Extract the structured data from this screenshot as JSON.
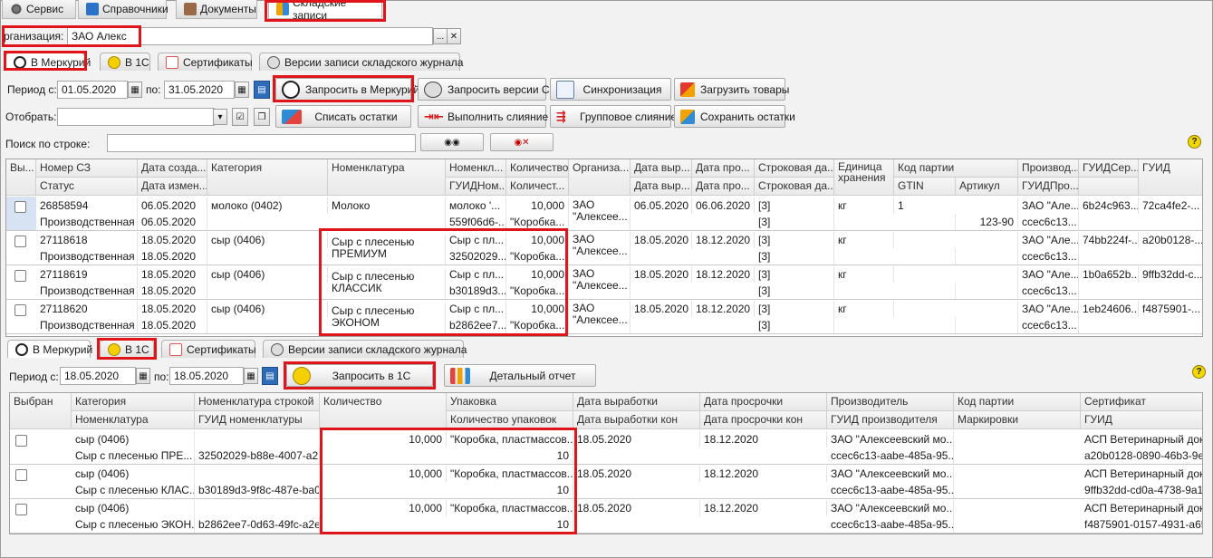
{
  "top_tabs": [
    {
      "label": "Сервис",
      "icon": "gear-icon"
    },
    {
      "label": "Справочники",
      "icon": "directory-icon"
    },
    {
      "label": "Документы",
      "icon": "documents-icon"
    },
    {
      "label": "Складские записи",
      "icon": "warehouse-icon"
    }
  ],
  "org": {
    "label": "рганизация:",
    "value": "ЗАО  Алекс"
  },
  "sub_tabs_top": [
    {
      "label": "В Меркурий",
      "icon": "mercury-icon"
    },
    {
      "label": "В 1С",
      "icon": "1c-icon"
    },
    {
      "label": "Сертификаты",
      "icon": "certificate-icon"
    },
    {
      "label": "Версии записи складского журнала",
      "icon": "versions-icon"
    }
  ],
  "filters": {
    "period_label": "Период с:",
    "from": "01.05.2020",
    "to_label": "по:",
    "to": "31.05.2020",
    "select_label": "Отобрать:",
    "select_value": "",
    "search_label": "Поиск по строке:",
    "search_value": ""
  },
  "buttons_top": {
    "request_mercury": "Запросить в Меркурий",
    "request_versions": "Запросить версии СЗ",
    "sync": "Синхронизация",
    "load_goods": "Загрузить товары",
    "write_off": "Списать остатки",
    "merge": "Выполнить слияние",
    "group_merge": "Групповое слияние",
    "save_rest": "Сохранить остатки"
  },
  "grid1": {
    "headers_row1": [
      "Вы...",
      "Номер СЗ",
      "Дата созда...",
      "Категория",
      "Номенклатура",
      "Номенкл...",
      "Количество",
      "Организа...",
      "Дата выр...",
      "Дата про...",
      "Строковая да...",
      "Единица хранения",
      "Код партии",
      "",
      "Производ...",
      "ГУИДСер...",
      "ГУИД"
    ],
    "headers_row2": [
      "",
      "Статус",
      "Дата измен...",
      "",
      "",
      "ГУИДНом...",
      "Количест...",
      "",
      "Дата выр...",
      "Дата про...",
      "Строковая да...",
      "",
      "GTIN",
      "Артикул",
      "ГУИДПро...",
      "",
      ""
    ],
    "rows": [
      {
        "num": "26858594",
        "status": "Производственная",
        "created": "06.05.2020",
        "changed": "06.05.2020",
        "category": "молоко (0402)",
        "nomen": "Молоко",
        "nomen_short": "молоко '...",
        "nomen_guid": "559f06d6-...",
        "qty": "10,000",
        "qty2": "\"Коробка...",
        "org": "ЗАО \"Алексее...",
        "prod_date": "06.05.2020",
        "exp_date": "06.06.2020",
        "str1": "[3]",
        "str2": "[3]",
        "unit": "кг",
        "batch": "1",
        "gtin": "",
        "article": "123-90",
        "producer": "ЗАО \"Але...",
        "producer_guid": "ccec6c13...",
        "cert_guid": "6b24c963...",
        "guid": "72ca4fe2-..."
      },
      {
        "num": "27118618",
        "status": "Производственная",
        "created": "18.05.2020",
        "changed": "18.05.2020",
        "category": "сыр (0406)",
        "nomen": "Сыр с плесенью ПРЕМИУМ",
        "nomen_short": "Сыр с пл...",
        "nomen_guid": "32502029...",
        "qty": "10,000",
        "qty2": "\"Коробка...",
        "org": "ЗАО \"Алексее...",
        "prod_date": "18.05.2020",
        "exp_date": "18.12.2020",
        "str1": "[3]",
        "str2": "[3]",
        "unit": "кг",
        "batch": "",
        "gtin": "",
        "article": "",
        "producer": "ЗАО \"Але...",
        "producer_guid": "ccec6c13...",
        "cert_guid": "74bb224f-...",
        "guid": "a20b0128-..."
      },
      {
        "num": "27118619",
        "status": "Производственная",
        "created": "18.05.2020",
        "changed": "18.05.2020",
        "category": "сыр (0406)",
        "nomen": "Сыр с плесенью КЛАССИК",
        "nomen_short": "Сыр с пл...",
        "nomen_guid": "b30189d3...",
        "qty": "10,000",
        "qty2": "\"Коробка...",
        "org": "ЗАО \"Алексее...",
        "prod_date": "18.05.2020",
        "exp_date": "18.12.2020",
        "str1": "[3]",
        "str2": "[3]",
        "unit": "кг",
        "batch": "",
        "gtin": "",
        "article": "",
        "producer": "ЗАО \"Але...",
        "producer_guid": "ccec6c13...",
        "cert_guid": "1b0a652b...",
        "guid": "9ffb32dd-c..."
      },
      {
        "num": "27118620",
        "status": "Производственная",
        "created": "18.05.2020",
        "changed": "18.05.2020",
        "category": "сыр (0406)",
        "nomen": "Сыр с плесенью ЭКОНОМ",
        "nomen_short": "Сыр с пл...",
        "nomen_guid": "b2862ee7...",
        "qty": "10,000",
        "qty2": "\"Коробка...",
        "org": "ЗАО \"Алексее...",
        "prod_date": "18.05.2020",
        "exp_date": "18.12.2020",
        "str1": "[3]",
        "str2": "[3]",
        "unit": "кг",
        "batch": "",
        "gtin": "",
        "article": "",
        "producer": "ЗАО \"Але...",
        "producer_guid": "ccec6c13...",
        "cert_guid": "1eb24606...",
        "guid": "f4875901-..."
      }
    ]
  },
  "sub_tabs_bottom": [
    {
      "label": "В Меркурий",
      "icon": "mercury-icon"
    },
    {
      "label": "В 1С",
      "icon": "1c-icon"
    },
    {
      "label": "Сертификаты",
      "icon": "certificate-icon"
    },
    {
      "label": "Версии записи складского журнала",
      "icon": "versions-icon"
    }
  ],
  "filters2": {
    "period_label": "Период с:",
    "from": "18.05.2020",
    "to_label": "по:",
    "to": "18.05.2020"
  },
  "buttons_bottom": {
    "request_1c": "Запросить в 1С",
    "report": "Детальный отчет"
  },
  "grid2": {
    "headers_row1": [
      "Выбран",
      "Категория",
      "Номенклатура строкой",
      "Количество",
      "Упаковка",
      "Дата выработки",
      "Дата просрочки",
      "Производитель",
      "Код партии",
      "Сертификат"
    ],
    "headers_row2": [
      "",
      "Номенклатура",
      "ГУИД номенклатуры",
      "",
      "Количество упаковок",
      "Дата выработки кон",
      "Дата просрочки кон",
      "ГУИД производителя",
      "Маркировки",
      "ГУИД"
    ],
    "rows": [
      {
        "category": "сыр (0406)",
        "nomen": "Сыр с плесенью ПРЕ...",
        "nomen_guid": "32502029-b88e-4007-a2...",
        "qty": "10,000",
        "pack": "\"Коробка, пластмассов...",
        "pack_qty": "10",
        "prod_date": "18.05.2020",
        "exp_date": "18.12.2020",
        "producer": "ЗАО \"Алексеевский мо...",
        "producer_guid": "ccec6c13-aabe-485a-95...",
        "cert": "АСП Ветеринарный док...",
        "cert_guid": "a20b0128-0890-46b3-9ec..."
      },
      {
        "category": "сыр (0406)",
        "nomen": "Сыр с плесенью КЛАС...",
        "nomen_guid": "b30189d3-9f8c-487e-ba0...",
        "qty": "10,000",
        "pack": "\"Коробка, пластмассов...",
        "pack_qty": "10",
        "prod_date": "18.05.2020",
        "exp_date": "18.12.2020",
        "producer": "ЗАО \"Алексеевский мо...",
        "producer_guid": "ccec6c13-aabe-485a-95...",
        "cert": "АСП Ветеринарный док...",
        "cert_guid": "9ffb32dd-cd0a-4738-9a1f-..."
      },
      {
        "category": "сыр (0406)",
        "nomen": "Сыр с плесенью ЭКОН...",
        "nomen_guid": "b2862ee7-0d63-49fc-a2e...",
        "qty": "10,000",
        "pack": "\"Коробка, пластмассов...",
        "pack_qty": "10",
        "prod_date": "18.05.2020",
        "exp_date": "18.12.2020",
        "producer": "ЗАО \"Алексеевский мо...",
        "producer_guid": "ccec6c13-aabe-485a-95...",
        "cert": "АСП Ветеринарный док...",
        "cert_guid": "f4875901-0157-4931-a65..."
      }
    ]
  },
  "colors": {
    "highlight": "#e0141b",
    "selected_row": "#d7e3f3"
  }
}
